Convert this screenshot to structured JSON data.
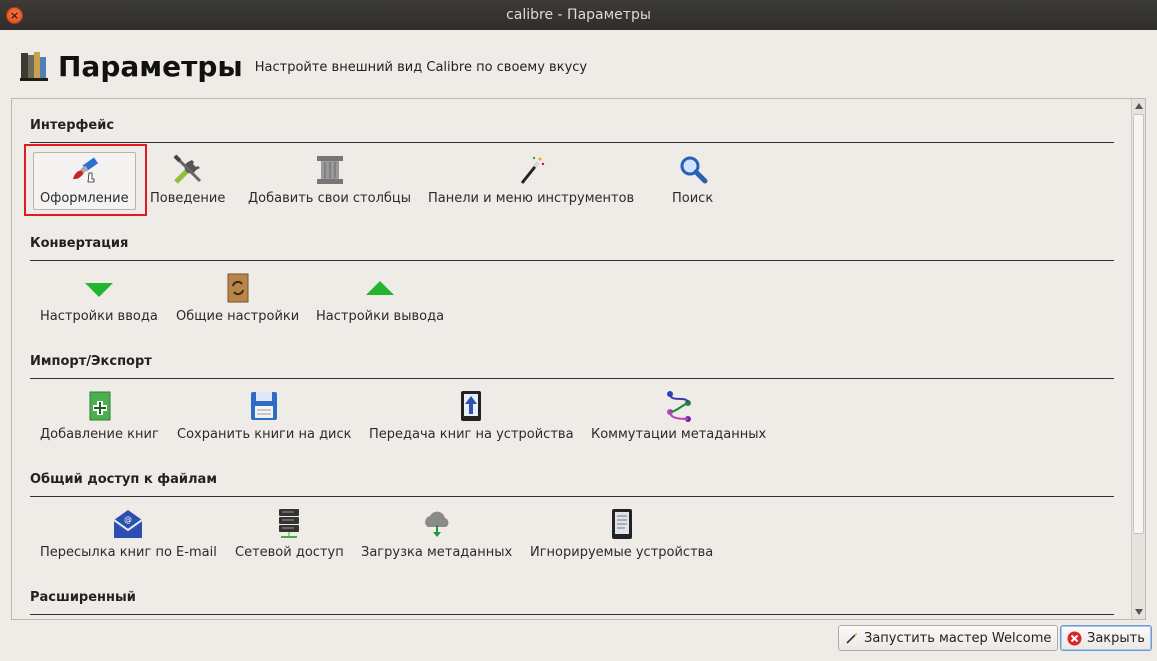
{
  "window": {
    "title": "calibre - Параметры"
  },
  "header": {
    "title": "Параметры",
    "subtitle": "Настройте внешний вид Calibre по своему вкусу"
  },
  "sections": [
    {
      "title": "Интерфейс",
      "items": [
        {
          "label": "Оформление",
          "icon": "paintbrush-icon"
        },
        {
          "label": "Поведение",
          "icon": "tools-icon"
        },
        {
          "label": "Добавить свои столбцы",
          "icon": "column-icon"
        },
        {
          "label": "Панели и меню инструментов",
          "icon": "wand-icon"
        },
        {
          "label": "Поиск",
          "icon": "search-icon"
        }
      ]
    },
    {
      "title": "Конвертация",
      "items": [
        {
          "label": "Настройки ввода",
          "icon": "arrow-down-icon"
        },
        {
          "label": "Общие настройки",
          "icon": "convert-book-icon"
        },
        {
          "label": "Настройки вывода",
          "icon": "arrow-up-icon"
        }
      ]
    },
    {
      "title": "Импорт/Экспорт",
      "items": [
        {
          "label": "Добавление книг",
          "icon": "add-book-icon"
        },
        {
          "label": "Сохранить книги на диск",
          "icon": "save-disk-icon"
        },
        {
          "label": "Передача книг на устройства",
          "icon": "device-upload-icon"
        },
        {
          "label": "Коммутации метаданных",
          "icon": "plugboard-icon"
        }
      ]
    },
    {
      "title": "Общий доступ к файлам",
      "items": [
        {
          "label": "Пересылка книг по E-mail",
          "icon": "mail-icon"
        },
        {
          "label": "Сетевой доступ",
          "icon": "server-icon"
        },
        {
          "label": "Загрузка метаданных",
          "icon": "cloud-download-icon"
        },
        {
          "label": "Игнорируемые устройства",
          "icon": "reader-device-icon"
        }
      ]
    },
    {
      "title": "Расширенный",
      "items": []
    }
  ],
  "buttons": {
    "wizard": "Запустить мастер Welcome",
    "close": "Закрыть"
  }
}
